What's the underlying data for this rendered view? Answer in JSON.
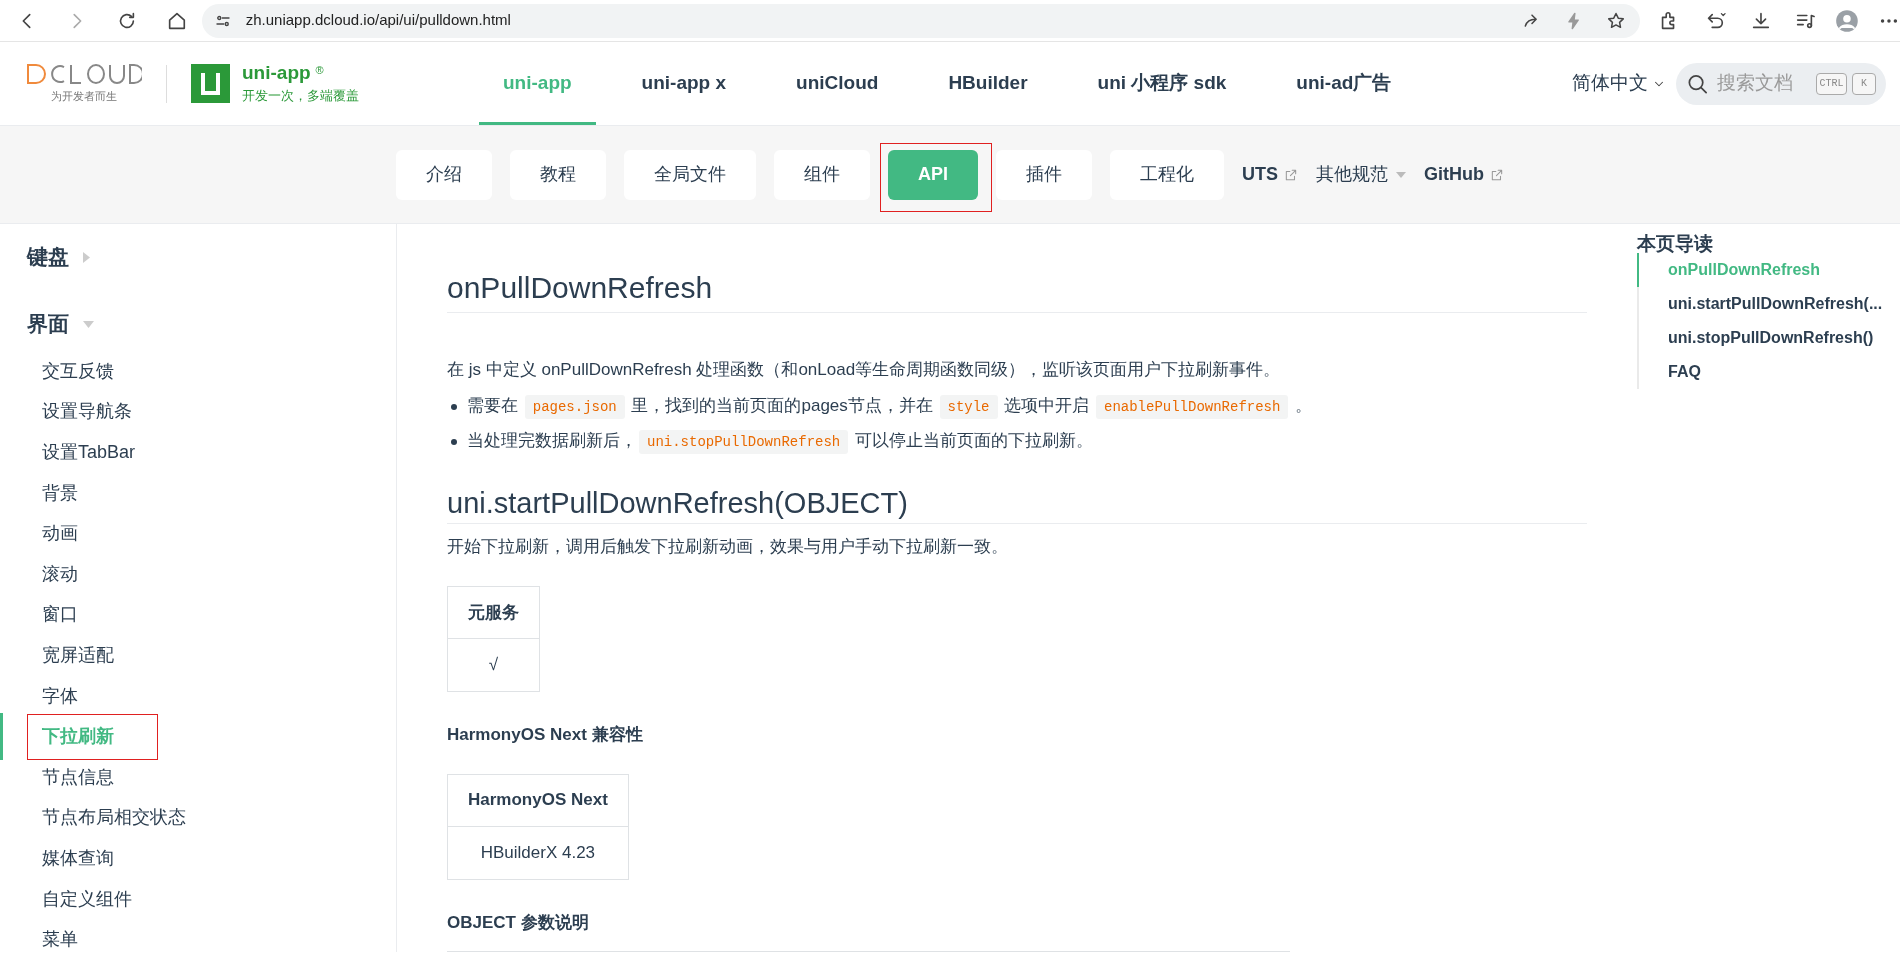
{
  "browser": {
    "url": "zh.uniapp.dcloud.io/api/ui/pulldown.html"
  },
  "header": {
    "logo_tagline": "为开发者而生",
    "product": {
      "name": "uni-app",
      "mark": "®",
      "slogan": "开发一次，多端覆盖"
    },
    "nav": [
      {
        "label": "uni-app",
        "selected": true
      },
      {
        "label": "uni-app x",
        "selected": false
      },
      {
        "label": "uniCloud",
        "selected": false
      },
      {
        "label": "HBuilder",
        "selected": false
      },
      {
        "label": "uni 小程序 sdk",
        "selected": false
      },
      {
        "label": "uni-ad广告",
        "selected": false
      }
    ],
    "language": "简体中文",
    "search": {
      "placeholder": "搜索文档",
      "keys": [
        "CTRL",
        "K"
      ]
    }
  },
  "subnav": [
    {
      "label": "介绍",
      "kind": "button",
      "selected": false,
      "annotated": false
    },
    {
      "label": "教程",
      "kind": "button",
      "selected": false,
      "annotated": false
    },
    {
      "label": "全局文件",
      "kind": "button",
      "selected": false,
      "annotated": false
    },
    {
      "label": "组件",
      "kind": "button",
      "selected": false,
      "annotated": false
    },
    {
      "label": "API",
      "kind": "button",
      "selected": true,
      "annotated": true
    },
    {
      "label": "插件",
      "kind": "button",
      "selected": false,
      "annotated": false
    },
    {
      "label": "工程化",
      "kind": "button",
      "selected": false,
      "annotated": false
    },
    {
      "label": "UTS",
      "kind": "external",
      "selected": false,
      "annotated": false
    },
    {
      "label": "其他规范",
      "kind": "dropdown",
      "selected": false,
      "annotated": false
    },
    {
      "label": "GitHub",
      "kind": "external",
      "selected": false,
      "annotated": false
    }
  ],
  "sidebar": {
    "sections": [
      {
        "title": "键盘",
        "expanded": false
      },
      {
        "title": "界面",
        "expanded": true,
        "children": [
          {
            "label": "交互反馈",
            "selected": false,
            "annotated": false
          },
          {
            "label": "设置导航条",
            "selected": false,
            "annotated": false
          },
          {
            "label": "设置TabBar",
            "selected": false,
            "annotated": false
          },
          {
            "label": "背景",
            "selected": false,
            "annotated": false
          },
          {
            "label": "动画",
            "selected": false,
            "annotated": false
          },
          {
            "label": "滚动",
            "selected": false,
            "annotated": false
          },
          {
            "label": "窗口",
            "selected": false,
            "annotated": false
          },
          {
            "label": "宽屏适配",
            "selected": false,
            "annotated": false
          },
          {
            "label": "字体",
            "selected": false,
            "annotated": false
          },
          {
            "label": "下拉刷新",
            "selected": true,
            "annotated": true
          },
          {
            "label": "节点信息",
            "selected": false,
            "annotated": false
          },
          {
            "label": "节点布局相交状态",
            "selected": false,
            "annotated": false
          },
          {
            "label": "媒体查询",
            "selected": false,
            "annotated": false
          },
          {
            "label": "自定义组件",
            "selected": false,
            "annotated": false
          },
          {
            "label": "菜单",
            "selected": false,
            "annotated": false
          }
        ]
      }
    ]
  },
  "content": [
    {
      "kind": "h1",
      "text": "onPullDownRefresh"
    },
    {
      "kind": "p",
      "parts": [
        {
          "kind": "text",
          "text": "在 js 中定义 onPullDownRefresh 处理函数（和onLoad等生命周期函数同级），监听该页面用户下拉刷新事件。"
        }
      ]
    },
    {
      "kind": "ul",
      "items": [
        [
          {
            "kind": "text",
            "text": "需要在 "
          },
          {
            "kind": "code",
            "text": "pages.json"
          },
          {
            "kind": "text",
            "text": " 里，找到的当前页面的pages节点，并在 "
          },
          {
            "kind": "code",
            "text": "style"
          },
          {
            "kind": "text",
            "text": " 选项中开启 "
          },
          {
            "kind": "code",
            "text": "enablePullDownRefresh"
          },
          {
            "kind": "text",
            "text": " 。"
          }
        ],
        [
          {
            "kind": "text",
            "text": "当处理完数据刷新后，"
          },
          {
            "kind": "code",
            "text": "uni.stopPullDownRefresh"
          },
          {
            "kind": "text",
            "text": " 可以停止当前页面的下拉刷新。"
          }
        ]
      ]
    },
    {
      "kind": "h2",
      "text": "uni.startPullDownRefresh(OBJECT)"
    },
    {
      "kind": "p",
      "parts": [
        {
          "kind": "text",
          "text": "开始下拉刷新，调用后触发下拉刷新动画，效果与用户手动下拉刷新一致。"
        }
      ]
    },
    {
      "kind": "table",
      "columns": [
        "元服务"
      ],
      "rows": [
        [
          "√"
        ]
      ]
    },
    {
      "kind": "h4",
      "text": "HarmonyOS Next 兼容性"
    },
    {
      "kind": "table",
      "columns": [
        "HarmonyOS Next"
      ],
      "rows": [
        [
          "HBuilderX 4.23"
        ]
      ]
    },
    {
      "kind": "h4",
      "text": "OBJECT 参数说明"
    },
    {
      "kind": "cut_table"
    }
  ],
  "toc": {
    "title": "本页导读",
    "items": [
      {
        "label": "onPullDownRefresh",
        "selected": true
      },
      {
        "label": "uni.startPullDownRefresh(...",
        "selected": false
      },
      {
        "label": "uni.stopPullDownRefresh()",
        "selected": false
      },
      {
        "label": "FAQ",
        "selected": false
      }
    ]
  }
}
